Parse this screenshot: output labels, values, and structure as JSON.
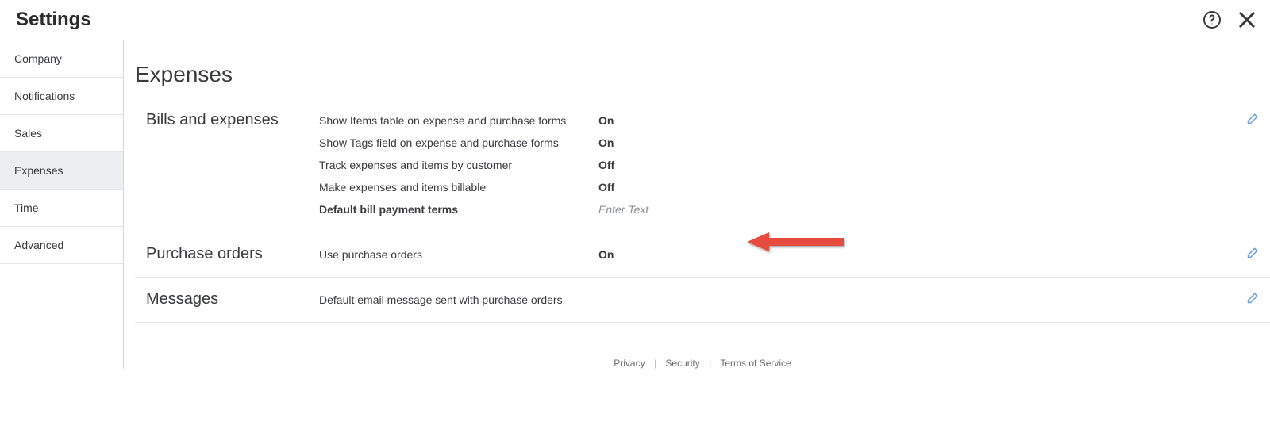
{
  "header": {
    "title": "Settings"
  },
  "sidebar": {
    "items": [
      {
        "label": "Company"
      },
      {
        "label": "Notifications"
      },
      {
        "label": "Sales"
      },
      {
        "label": "Expenses"
      },
      {
        "label": "Time"
      },
      {
        "label": "Advanced"
      }
    ],
    "active_index": 3
  },
  "page": {
    "title": "Expenses"
  },
  "sections": {
    "bills": {
      "title": "Bills and expenses",
      "rows": [
        {
          "label": "Show Items table on expense and purchase forms",
          "value": "On"
        },
        {
          "label": "Show Tags field on expense and purchase forms",
          "value": "On"
        },
        {
          "label": "Track expenses and items by customer",
          "value": "Off"
        },
        {
          "label": "Make expenses and items billable",
          "value": "Off"
        }
      ],
      "terms_label": "Default bill payment terms",
      "terms_placeholder": "Enter Text"
    },
    "purchase": {
      "title": "Purchase orders",
      "row": {
        "label": "Use purchase orders",
        "value": "On"
      }
    },
    "messages": {
      "title": "Messages",
      "row": {
        "label": "Default email message sent with purchase orders"
      }
    }
  },
  "footer": {
    "privacy": "Privacy",
    "security": "Security",
    "tos": "Terms of Service"
  }
}
